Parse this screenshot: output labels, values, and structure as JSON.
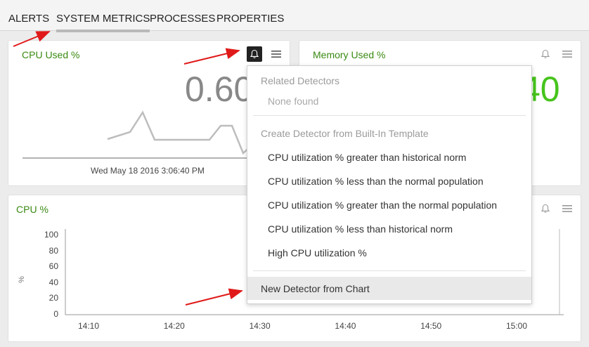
{
  "tabs": [
    {
      "label": "ALERTS"
    },
    {
      "label": "SYSTEM METRICS",
      "active": true
    },
    {
      "label": "PROCESSES"
    },
    {
      "label": "PROPERTIES"
    }
  ],
  "cpu_card": {
    "title": "CPU Used %",
    "value": "0.60",
    "timestamp": "Wed May 18 2016 3:06:40 PM"
  },
  "memory_card": {
    "title": "Memory Used %",
    "value": "40"
  },
  "cpu_chart_card": {
    "title": "CPU %",
    "y_axis_symbol": "%"
  },
  "chart_data": {
    "type": "line",
    "title": "CPU %",
    "ylabel": "%",
    "yticks": [
      "100",
      "80",
      "60",
      "40",
      "20",
      "0"
    ],
    "xticks": [
      "14:10",
      "14:20",
      "14:30",
      "14:40",
      "14:50",
      "15:00"
    ],
    "ylim": [
      0,
      100
    ],
    "series": []
  },
  "dropdown": {
    "related_header": "Related Detectors",
    "none_found": "None found",
    "template_header": "Create Detector from Built-In Template",
    "templates": [
      "CPU utilization % greater than historical norm",
      "CPU utilization % less than the normal population",
      "CPU utilization % greater than the normal population",
      "CPU utilization % less than historical norm",
      "High CPU utilization %"
    ],
    "new_detector": "New Detector from Chart"
  },
  "colors": {
    "title_green": "#3a8a12",
    "value_green": "#46c41c",
    "annotation_red": "#e01a1a"
  }
}
